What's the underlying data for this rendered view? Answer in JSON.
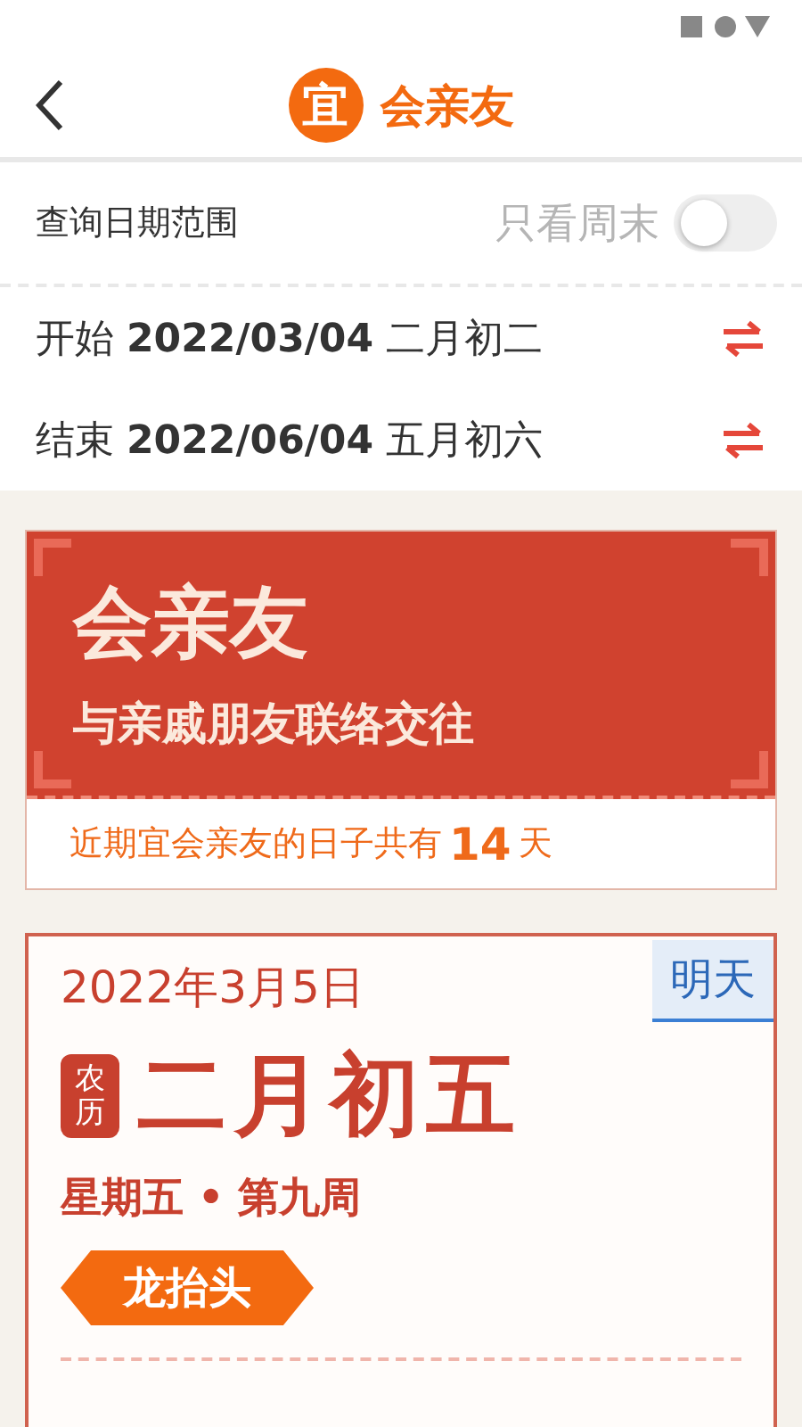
{
  "header": {
    "badge": "宜",
    "title": "会亲友"
  },
  "filter": {
    "label": "查询日期范围",
    "weekend_only": {
      "label": "只看周末",
      "on": false
    }
  },
  "range": [
    {
      "prefix": "开始",
      "date": "2022/03/04",
      "lunar": "二月初二"
    },
    {
      "prefix": "结束",
      "date": "2022/06/04",
      "lunar": "五月初六"
    }
  ],
  "banner": {
    "title": "会亲友",
    "subtitle": "与亲戚朋友联络交往",
    "summary": "近期宜会亲友的日子共有 **14** 天"
  },
  "day": {
    "date": "2022年3月5日",
    "tag": "明天",
    "lunar_label": "农历",
    "lunar_date": "二月初五",
    "weekday": "星期五 • 第九周",
    "festival": "龙抬头"
  }
}
